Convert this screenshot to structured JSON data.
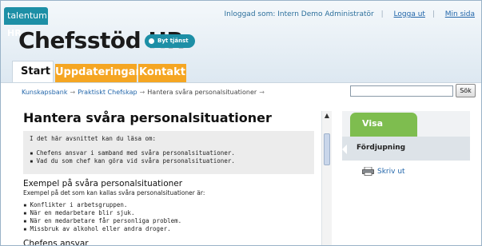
{
  "header": {
    "logo": {
      "prefix": "talentum",
      "suffix": "HR"
    },
    "app_title": "Chefsstöd HR",
    "switch_service_label": "Byt tjänst",
    "logged_in_text": "Inloggad som: Intern Demo Administratör",
    "logout_label": "Logga ut",
    "my_page_label": "Min sida",
    "separator": "|"
  },
  "tabs": [
    {
      "label": "Start",
      "active": true
    },
    {
      "label": "Uppdateringar",
      "active": false
    },
    {
      "label": "Kontakt",
      "active": false
    }
  ],
  "breadcrumb": {
    "items": [
      "Kunskapsbank",
      "Praktiskt Chefskap",
      "Hantera svåra personalsituationer"
    ],
    "arrow": "→"
  },
  "search": {
    "value": "",
    "button_label": "Sök"
  },
  "article": {
    "title": "Hantera svåra personalsituationer",
    "intro_text": "I det här avsnittet kan du läsa om:",
    "intro_bullets": [
      "Chefens ansvar i samband med svåra personalsituationer.",
      "Vad du som chef kan göra vid svåra personalsituationer."
    ],
    "examples_heading": "Exempel på svåra personalsituationer",
    "examples_text": "Exempel på det som kan kallas svåra personalsituationer är:",
    "examples_bullets": [
      "Konflikter i arbetsgruppen.",
      "När en medarbetare blir sjuk.",
      "När en medarbetare får personliga problem.",
      "Missbruk av alkohol eller andra droger."
    ],
    "responsibility_heading": "Chefens ansvar"
  },
  "sidebar": {
    "show_only_label": "Visa endast",
    "filter_label": "Fördjupning",
    "print_label": "Skriv ut"
  },
  "colors": {
    "brand": "#1d8fa6",
    "tab_orange": "#f5a623",
    "panel_green": "#7ebd4f",
    "link": "#2266aa"
  },
  "icons": {
    "switch_service": "dot-icon",
    "print": "printer-icon",
    "scroll_up": "chevron-up-icon"
  }
}
